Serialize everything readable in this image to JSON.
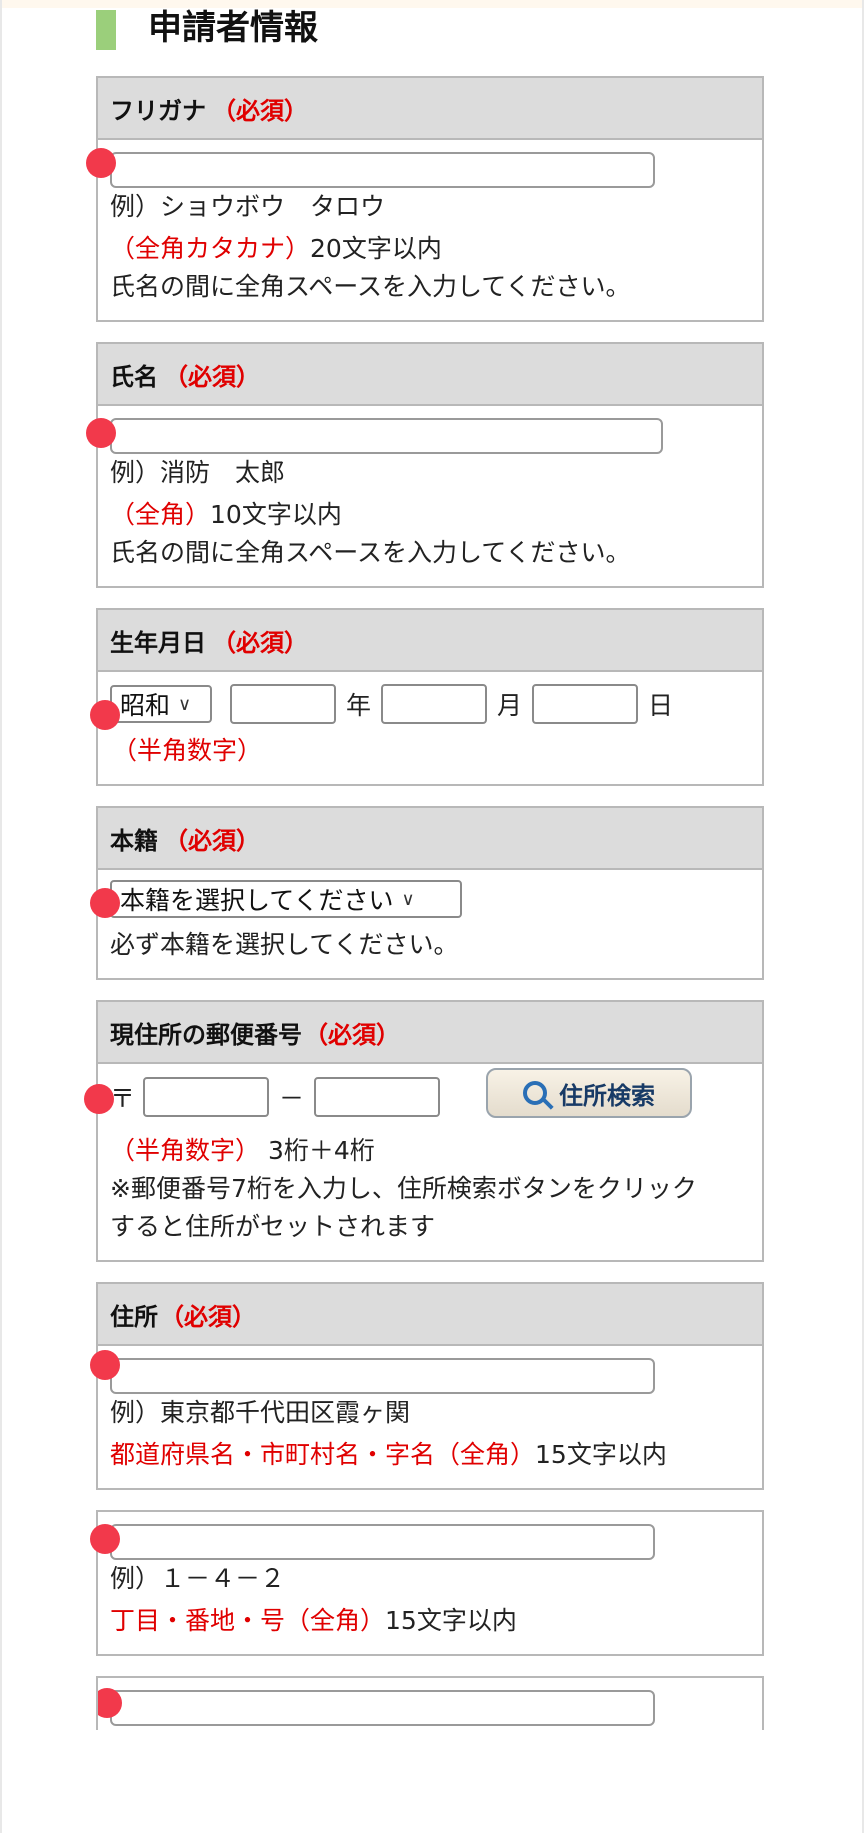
{
  "section": {
    "title": "申請者情報"
  },
  "required_label": "（必須）",
  "furigana": {
    "label": "フリガナ",
    "value": "",
    "example": "例）ショウボウ　タロウ",
    "rule_red": "（全角カタカナ）",
    "rule_rest": "20文字以内",
    "note": "氏名の間に全角スペースを入力してください。"
  },
  "name": {
    "label": "氏名",
    "value": "",
    "example": "例）消防　太郎",
    "rule_red": "（全角）",
    "rule_rest": "10文字以内",
    "note": "氏名の間に全角スペースを入力してください。"
  },
  "birth": {
    "label": "生年月日",
    "era_selected": "昭和",
    "year_unit": "年",
    "month_unit": "月",
    "day_unit": "日",
    "hint": "（半角数字）"
  },
  "honseki": {
    "label": "本籍",
    "selected": "本籍を選択してください",
    "note": "必ず本籍を選択してください。"
  },
  "postal": {
    "label": "現住所の郵便番号",
    "mark": "〒",
    "dash": "－",
    "search_button": "住所検索",
    "rule_red": "（半角数字）",
    "rule_rest": "3桁＋4桁",
    "note1": "※郵便番号7桁を入力し、住所検索ボタンをクリック",
    "note2": "すると住所がセットされます"
  },
  "address": {
    "label": "住所",
    "example": "例）東京都千代田区霞ヶ関",
    "rule_red": "都道府県名・市町村名・字名（全角）",
    "rule_rest": "15文字以内"
  },
  "address2": {
    "example": "例）１－４－２",
    "rule_red": "丁目・番地・号（全角）",
    "rule_rest": "15文字以内"
  },
  "icons": {
    "search": "magnifier-icon",
    "chevron": "chevron-down-icon",
    "marker": "red-dot-marker"
  },
  "colors": {
    "required": "#e00000",
    "marker": "#f2394b",
    "section_bar": "#9bcf7b",
    "header_bg": "#dcdcdc"
  }
}
